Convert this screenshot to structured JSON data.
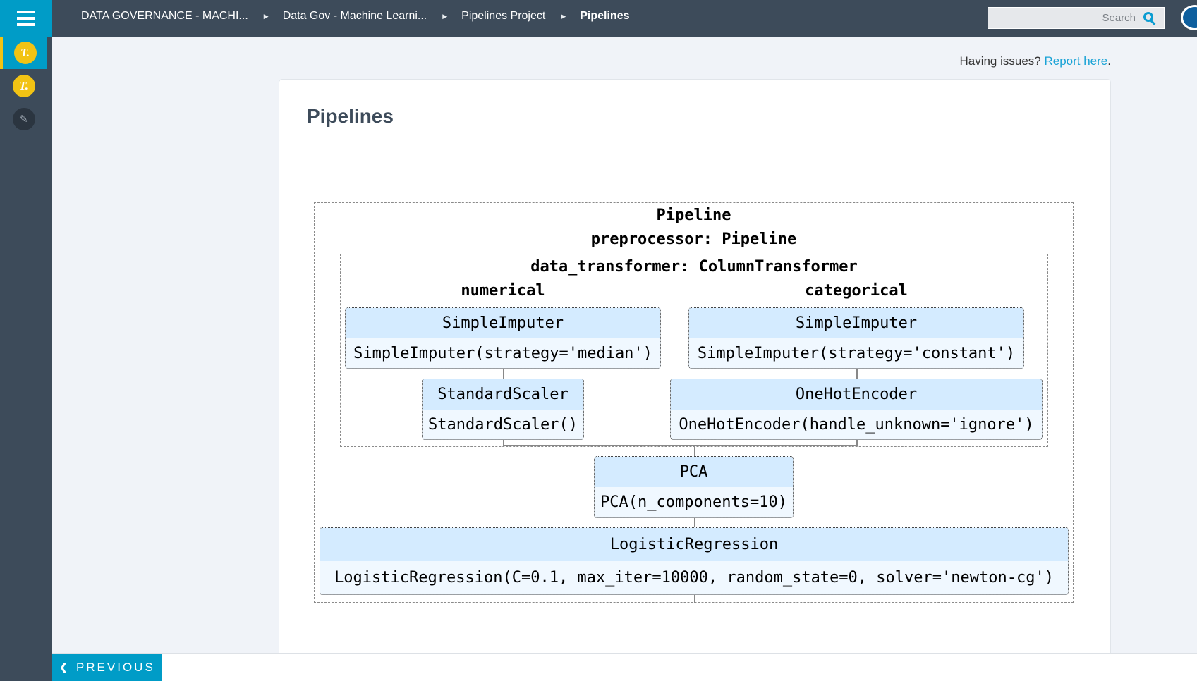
{
  "topbar": {
    "menu_icon": "hamburger-icon",
    "breadcrumb": [
      {
        "label": "DATA GOVERNANCE - MACHI..."
      },
      {
        "label": "Data Gov - Machine Learni..."
      },
      {
        "label": "Pipelines Project"
      },
      {
        "label": "Pipelines"
      }
    ],
    "separator": "▶",
    "search": {
      "placeholder": "Search",
      "value": ""
    }
  },
  "sidebar": {
    "items": [
      {
        "glyph": "T.",
        "icon": "terminal-icon",
        "active": true
      },
      {
        "glyph": "T.",
        "icon": "terminal-icon",
        "active": false
      },
      {
        "glyph": "✎",
        "icon": "edit-icon",
        "active": false
      }
    ]
  },
  "notice": {
    "text": "Having issues? ",
    "link": "Report here",
    "suffix": "."
  },
  "page": {
    "title": "Pipelines"
  },
  "pipeline": {
    "root_label": "Pipeline",
    "preprocessor_label": "preprocessor: Pipeline",
    "transformer_label": "data_transformer: ColumnTransformer",
    "numerical_label": "numerical",
    "categorical_label": "categorical",
    "numerical_steps": [
      {
        "name": "SimpleImputer",
        "params": "SimpleImputer(strategy='median')"
      },
      {
        "name": "StandardScaler",
        "params": "StandardScaler()"
      }
    ],
    "categorical_steps": [
      {
        "name": "SimpleImputer",
        "params": "SimpleImputer(strategy='constant')"
      },
      {
        "name": "OneHotEncoder",
        "params": "OneHotEncoder(handle_unknown='ignore')"
      }
    ],
    "pca": {
      "name": "PCA",
      "params": "PCA(n_components=10)"
    },
    "classifier": {
      "name": "LogisticRegression",
      "params": "LogisticRegression(C=0.1, max_iter=10000, random_state=0, solver='newton-cg')"
    }
  },
  "footer": {
    "previous_label": "PREVIOUS",
    "previous_icon": "chevron-left-icon"
  }
}
